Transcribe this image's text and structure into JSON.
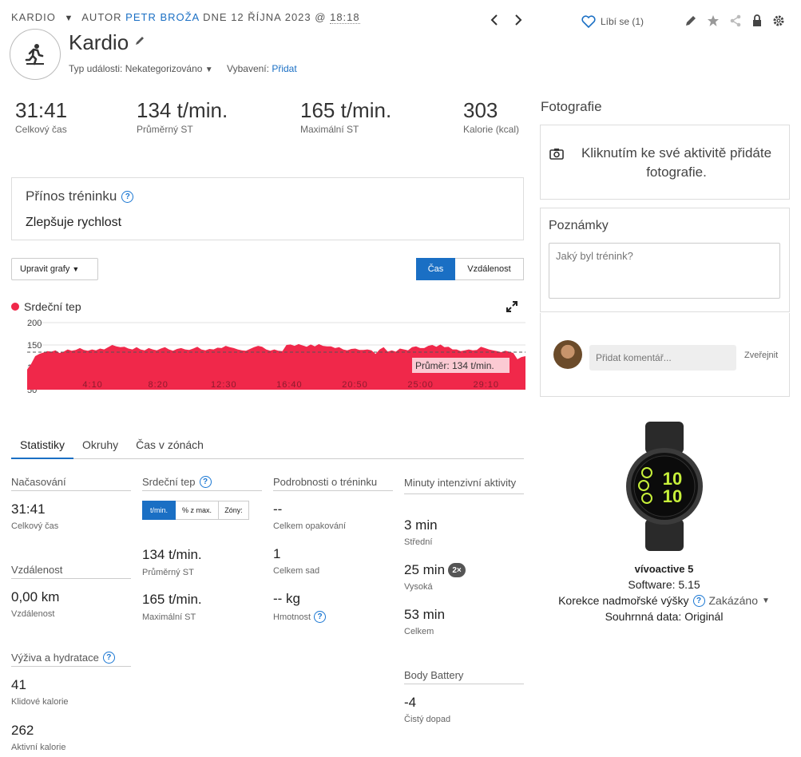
{
  "header": {
    "activity_type": "KARDIO",
    "author_prefix": "AUTOR",
    "author_name": "PETR BROŽA",
    "date_prefix": "DNE 12 ŘÍJNA 2023 @",
    "time": "18:18",
    "title": "Kardio",
    "event_type_label": "Typ události:",
    "event_type_value": "Nekategorizováno",
    "gear_label": "Vybavení:",
    "gear_add": "Přidat",
    "like_label": "Líbí se (1)"
  },
  "stats": [
    {
      "value": "31:41",
      "label": "Celkový čas"
    },
    {
      "value": "134 t/min.",
      "label": "Průměrný ST"
    },
    {
      "value": "165 t/min.",
      "label": "Maximální ST"
    },
    {
      "value": "303",
      "label": "Kalorie (kcal)"
    }
  ],
  "training_effect": {
    "title": "Přínos tréninku",
    "value": "Zlepšuje rychlost"
  },
  "chart_controls": {
    "edit": "Upravit grafy",
    "time": "Čas",
    "distance": "Vzdálenost"
  },
  "chart_data": {
    "type": "area",
    "title": "Srdeční tep",
    "ylim": [
      50,
      200
    ],
    "y_ticks": [
      "200",
      "150",
      "100",
      "50"
    ],
    "x_ticks": [
      "4:10",
      "8:20",
      "12:30",
      "16:40",
      "20:50",
      "25:00",
      "29:10"
    ],
    "average_label": "Průměr: 134 t/min.",
    "average": 134,
    "color": "#f0284a",
    "series": [
      {
        "values": [
          95,
          108,
          125,
          130,
          133,
          136,
          135,
          138,
          132,
          135,
          140,
          137,
          139,
          143,
          139,
          137,
          140,
          138,
          142,
          140,
          145,
          150,
          147,
          145,
          146,
          142,
          140,
          145,
          140,
          138,
          143,
          140,
          138,
          142,
          145,
          140,
          137,
          141,
          143,
          140,
          139,
          142,
          146,
          140,
          138,
          141,
          140,
          144,
          143,
          148,
          145,
          143,
          140,
          138,
          137,
          141,
          145,
          148,
          146,
          140,
          137,
          140,
          137,
          136,
          150,
          151,
          148,
          152,
          149,
          146,
          151,
          147,
          152,
          148,
          147,
          147,
          143,
          145,
          140,
          138,
          141,
          142,
          139,
          139,
          140,
          138,
          130,
          140,
          145,
          135,
          138,
          135,
          142,
          140,
          138,
          145,
          147,
          143,
          143,
          148,
          150,
          146,
          151,
          145,
          146,
          140,
          140,
          136,
          138,
          140,
          138,
          139,
          146,
          143,
          140,
          138,
          136,
          134,
          137,
          135,
          132,
          118,
          123,
          125
        ]
      }
    ]
  },
  "tabs": [
    "Statistiky",
    "Okruhy",
    "Čas v zónách"
  ],
  "timing": {
    "title": "Načasování",
    "value": "31:41",
    "label": "Celkový čas"
  },
  "distance": {
    "title": "Vzdálenost",
    "value": "0,00 km",
    "label": "Vzdálenost"
  },
  "nutrition": {
    "title": "Výživa a hydratace",
    "resting_value": "41",
    "resting_label": "Klidové kalorie",
    "active_value": "262",
    "active_label": "Aktivní kalorie"
  },
  "heart": {
    "title": "Srdeční tep",
    "toggle": [
      "t/min.",
      "% z max.",
      "Zóny:"
    ],
    "avg_value": "134 t/min.",
    "avg_label": "Průměrný ST",
    "max_value": "165 t/min.",
    "max_label": "Maximální ST"
  },
  "details": {
    "title": "Podrobnosti o tréninku",
    "reps_value": "--",
    "reps_label": "Celkem opakování",
    "sets_value": "1",
    "sets_label": "Celkem sad",
    "weight_value": "-- kg",
    "weight_label": "Hmotnost"
  },
  "intensity": {
    "title": "Minuty intenzivní aktivity",
    "moderate_value": "3 min",
    "moderate_label": "Střední",
    "vigorous_value": "25 min",
    "vigorous_badge": "2×",
    "vigorous_label": "Vysoká",
    "total_value": "53 min",
    "total_label": "Celkem"
  },
  "body_battery": {
    "title": "Body Battery",
    "value": "-4",
    "label": "Čistý dopad"
  },
  "photos": {
    "title": "Fotografie",
    "text": "Kliknutím ke své aktivitě přidáte fotografie."
  },
  "notes": {
    "title": "Poznámky",
    "placeholder": "Jaký byl trénink?"
  },
  "comment": {
    "placeholder": "Přidat komentář...",
    "publish": "Zveřejnit"
  },
  "device": {
    "name": "vívoactive 5",
    "software": "Software: 5.15",
    "elev_label": "Korekce nadmořské výšky",
    "elev_value": "Zakázáno",
    "summary": "Souhrnná data: Originál",
    "watch_time_top": "10",
    "watch_time_bottom": "10"
  }
}
